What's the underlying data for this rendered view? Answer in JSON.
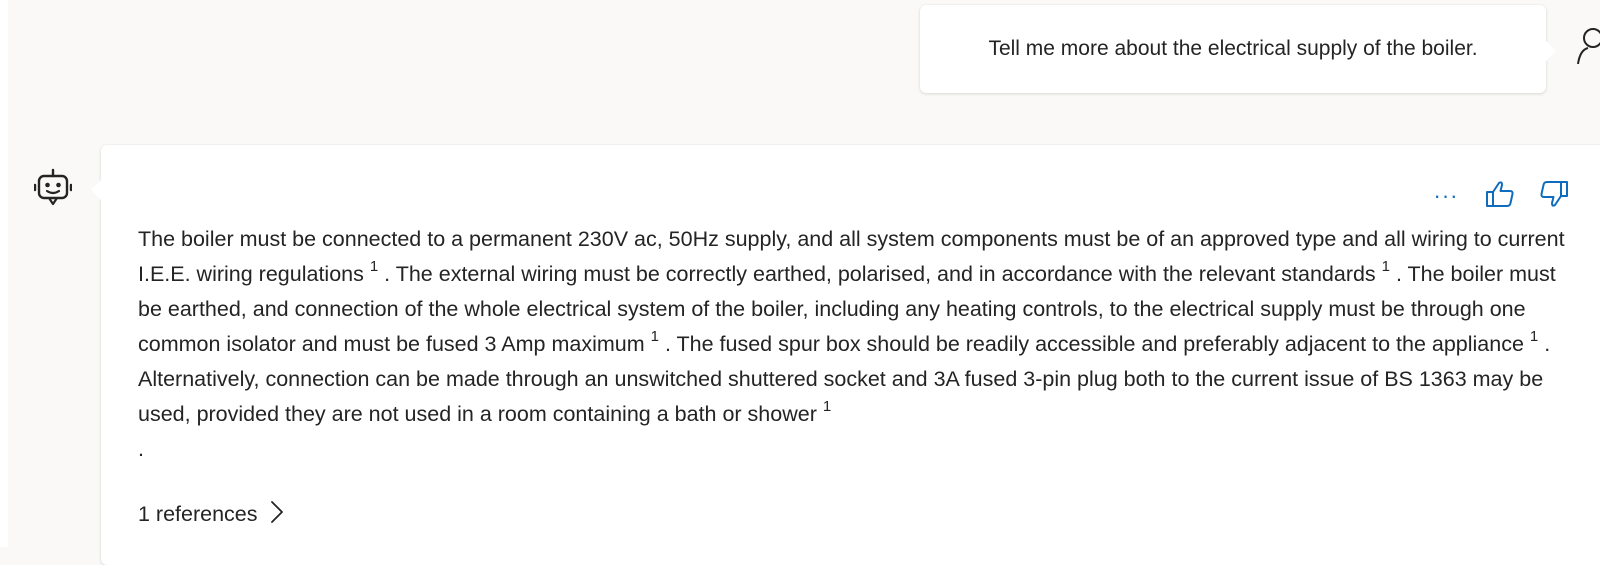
{
  "user_message": {
    "text": "Tell me more about the electrical supply of the boiler."
  },
  "bot_message": {
    "segments": [
      {
        "text": "The boiler must be connected to a permanent 230V ac, 50Hz supply, and all system components must be of an approved type and all wiring to current I.E.E. wiring regulations ",
        "cite": "1"
      },
      {
        "text": " . The external wiring must be correctly earthed, polarised, and in accordance with the relevant standards ",
        "cite": "1"
      },
      {
        "text": " . The boiler must be earthed, and connection of the whole electrical system of the boiler, including any heating controls, to the electrical supply must be through one common isolator and must be fused 3 Amp maximum ",
        "cite": "1"
      },
      {
        "text": " . The fused spur box should be readily accessible and preferably adjacent to the appliance ",
        "cite": "1"
      },
      {
        "text": " . Alternatively, connection can be made through an unswitched shuttered socket and 3A fused 3-pin plug both to the current issue of BS 1363 may be used, provided they are not used in a room containing a bath or shower ",
        "cite": "1"
      }
    ],
    "trailing": ".",
    "actions": {
      "more_label": "···",
      "thumbs_up_icon": "thumbs-up-icon",
      "thumbs_down_icon": "thumbs-down-icon"
    },
    "references_label": "1 references"
  },
  "colors": {
    "background": "#faf9f8",
    "bubble": "#ffffff",
    "accent": "#0f6cbd",
    "text": "#242424"
  },
  "icons": {
    "user": "person-icon",
    "bot": "bot-icon",
    "references": "chevron-right-icon"
  }
}
